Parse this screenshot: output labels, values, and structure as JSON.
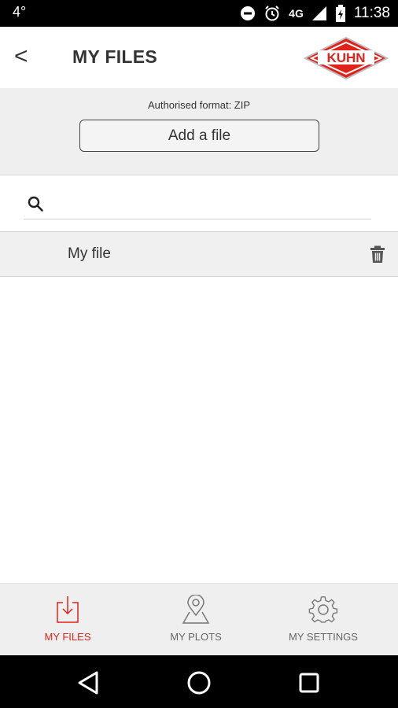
{
  "status_bar": {
    "left_icon": "4°",
    "network": "4G",
    "time": "11:38"
  },
  "header": {
    "back_label": "<",
    "title": "MY FILES",
    "logo_text": "KUHN"
  },
  "upload": {
    "authorised_format": "Authorised format: ZIP",
    "add_button_label": "Add a file"
  },
  "search": {
    "value": "",
    "placeholder": ""
  },
  "files": [
    {
      "name": "My file"
    }
  ],
  "bottom_nav": {
    "items": [
      {
        "label": "MY FILES",
        "icon": "download-icon",
        "active": true
      },
      {
        "label": "MY PLOTS",
        "icon": "map-pin-icon",
        "active": false
      },
      {
        "label": "MY SETTINGS",
        "icon": "gear-icon",
        "active": false
      }
    ]
  },
  "colors": {
    "accent": "#e0221b",
    "nav_inactive": "#666666",
    "panel_bg": "#efefef"
  }
}
